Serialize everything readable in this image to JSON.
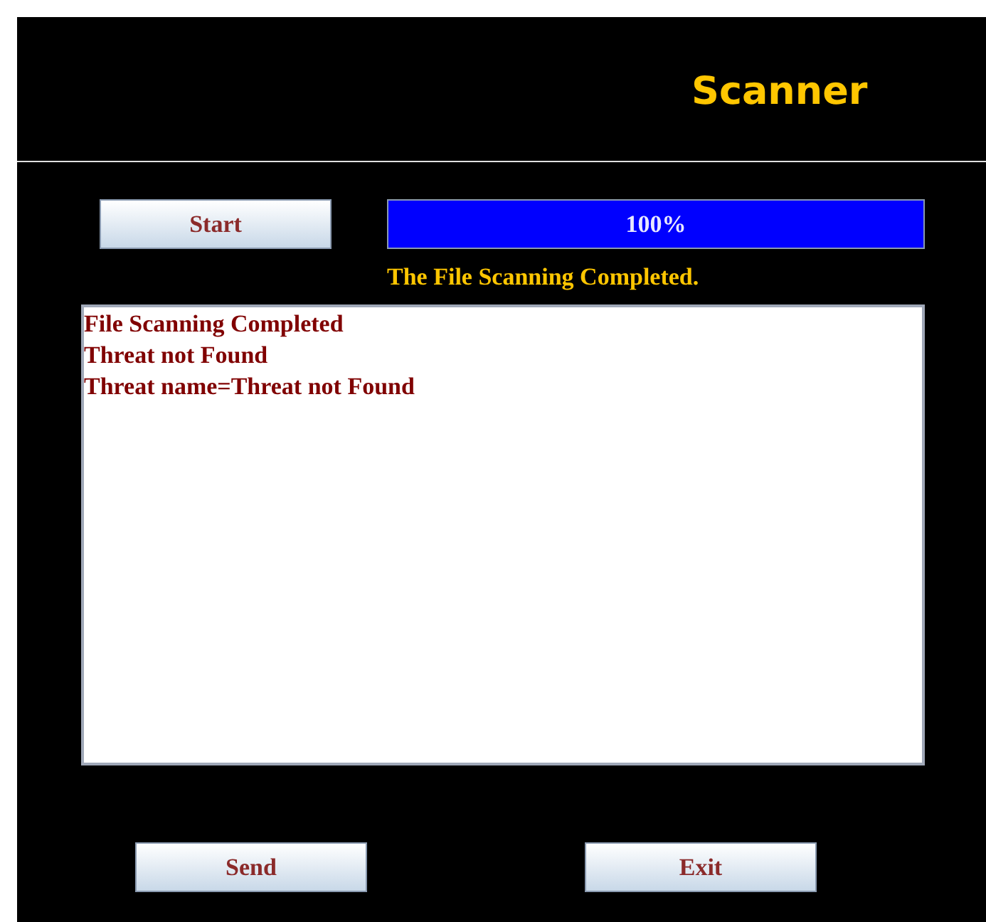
{
  "window": {
    "title": "Scanner"
  },
  "start_button": {
    "label": "Start"
  },
  "progress": {
    "level": 1,
    "reading": "100%"
  },
  "status": "The File Scanning Completed.",
  "log": [
    "File Scanning Completed",
    "Threat not Found",
    "Threat name=Threat not Found"
  ],
  "buttons": [
    {
      "label": "Send"
    },
    {
      "label": "Exit"
    }
  ]
}
